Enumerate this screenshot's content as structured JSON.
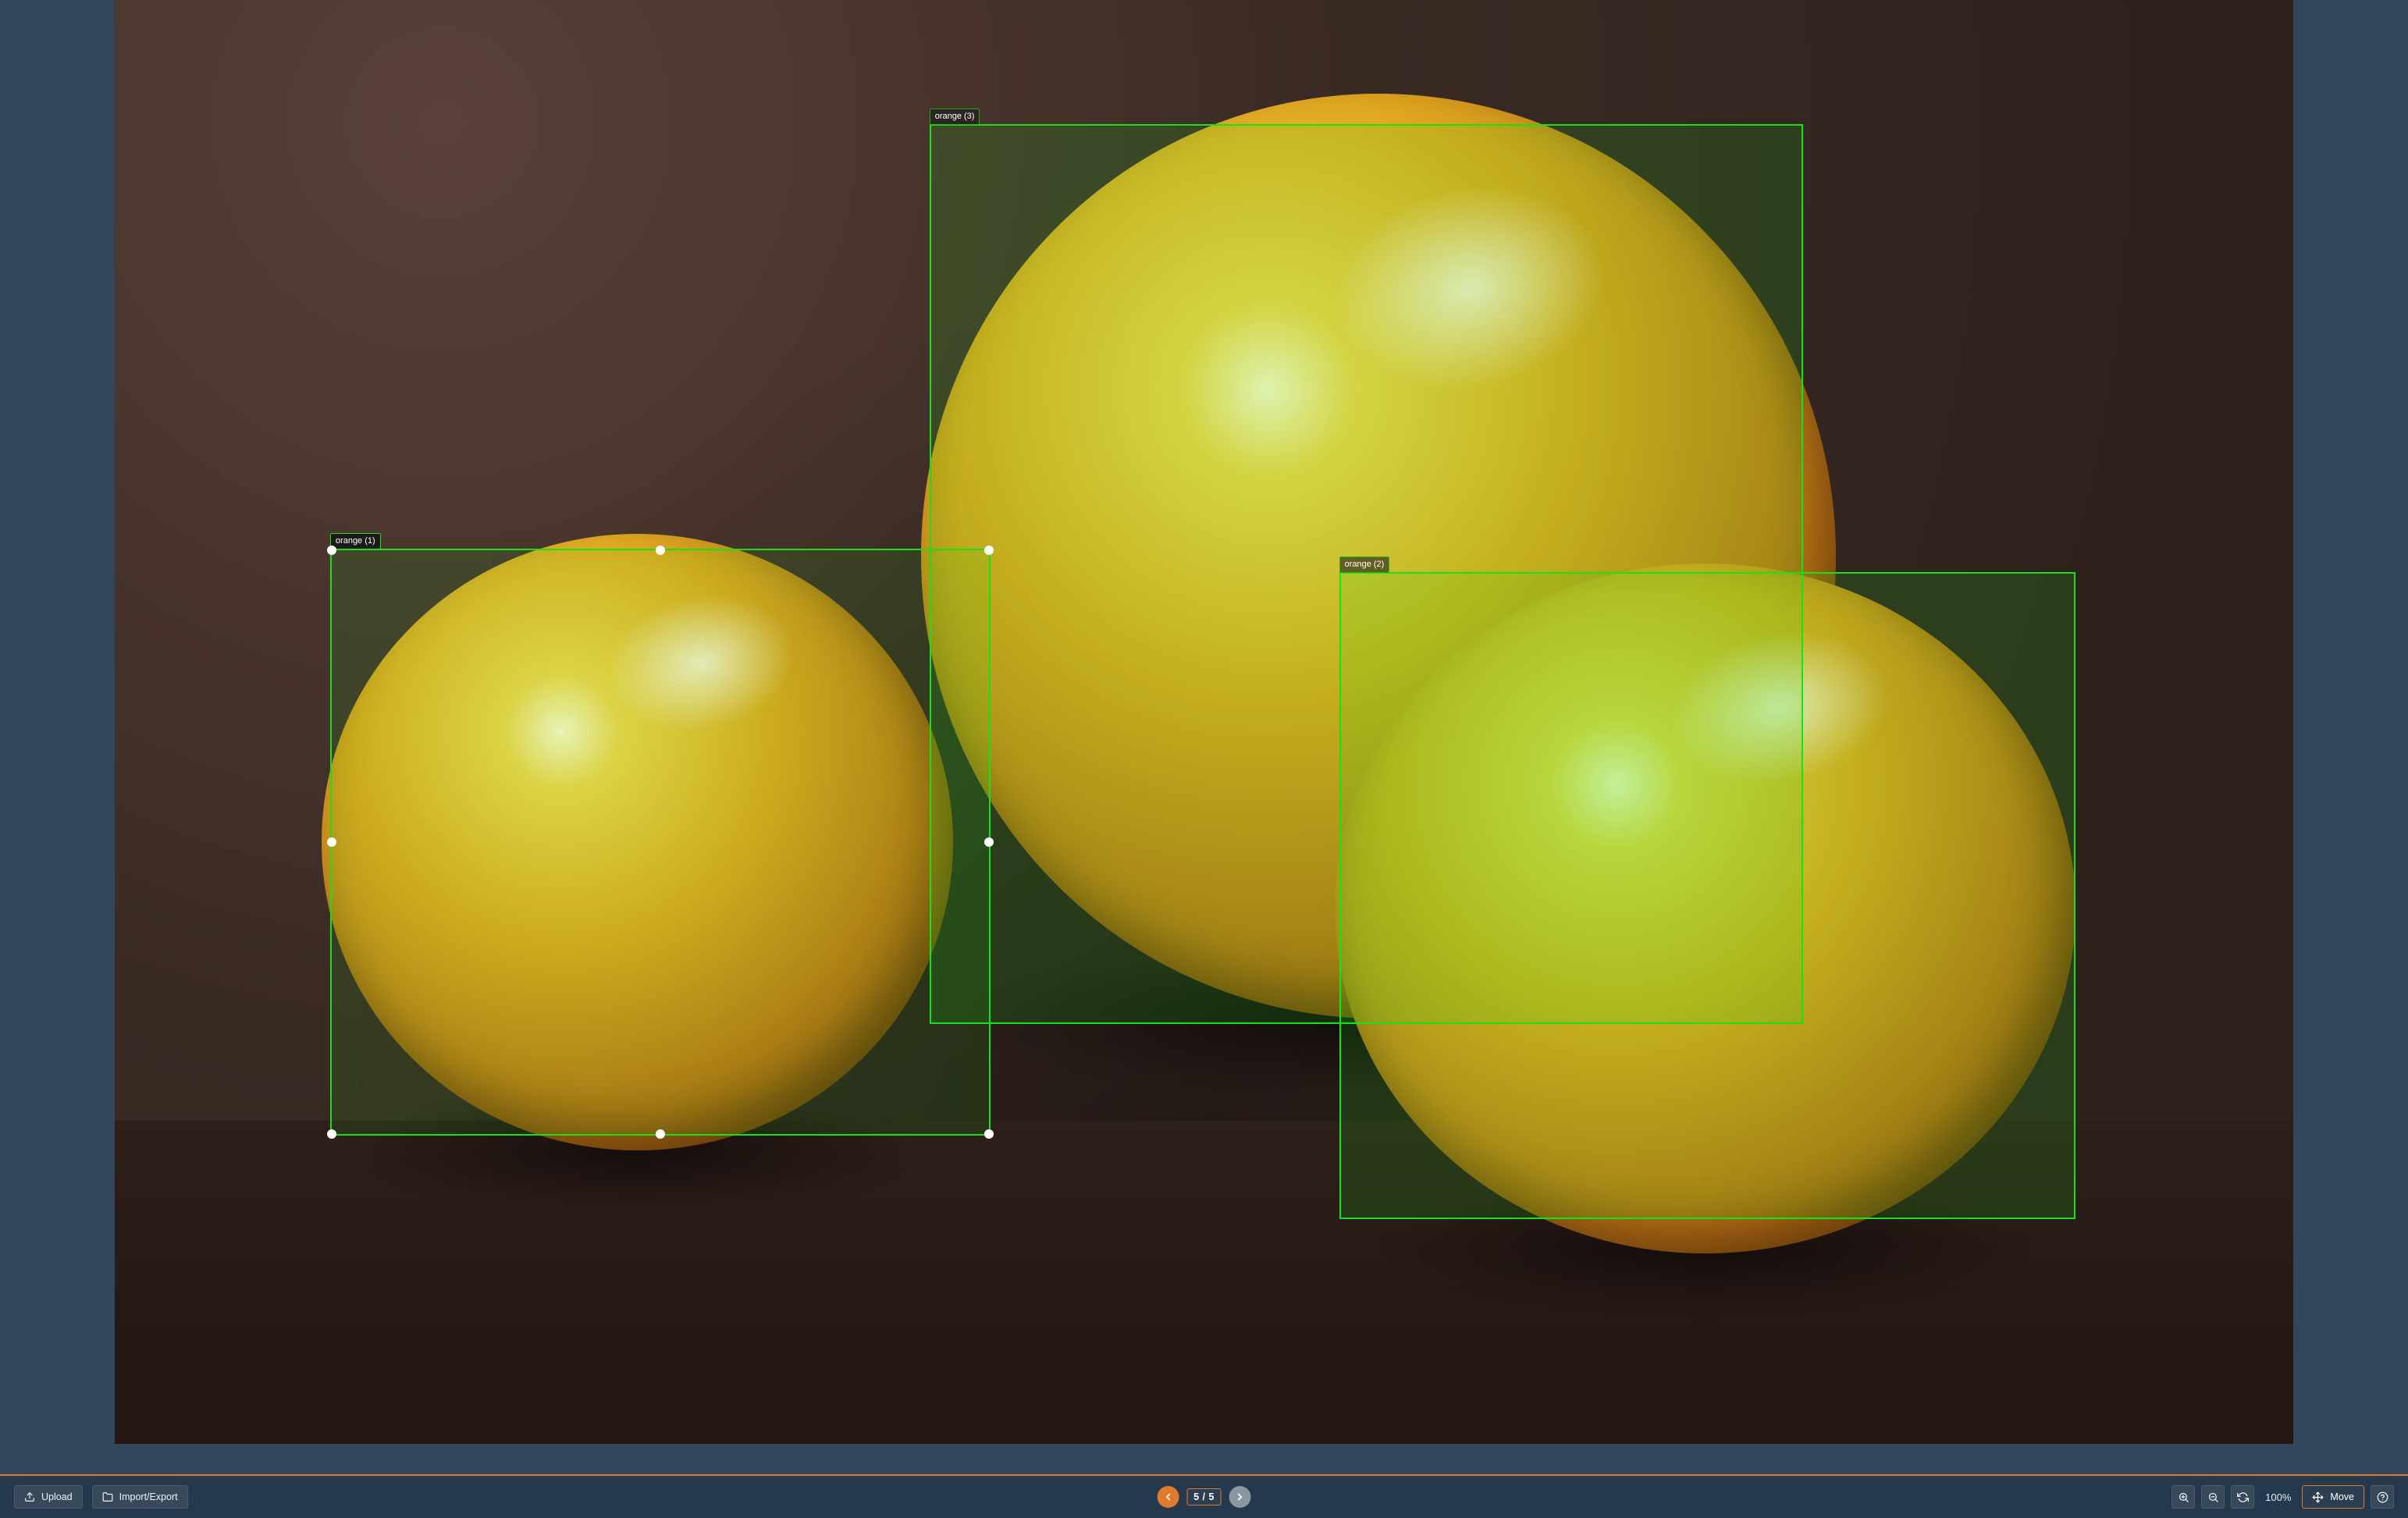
{
  "annotations": {
    "box1": {
      "label": "orange (1)",
      "selected": true
    },
    "box2": {
      "label": "orange (2)",
      "selected": false
    },
    "box3": {
      "label": "orange (3)",
      "selected": false
    }
  },
  "toolbar": {
    "upload_label": "Upload",
    "import_export_label": "Import/Export",
    "move_label": "Move",
    "zoom_level": "100%"
  },
  "pager": {
    "counter": "5 / 5"
  },
  "colors": {
    "accent": "#e07b2e",
    "box": "#17e217",
    "panel": "#32475b",
    "bar": "#24394d"
  }
}
